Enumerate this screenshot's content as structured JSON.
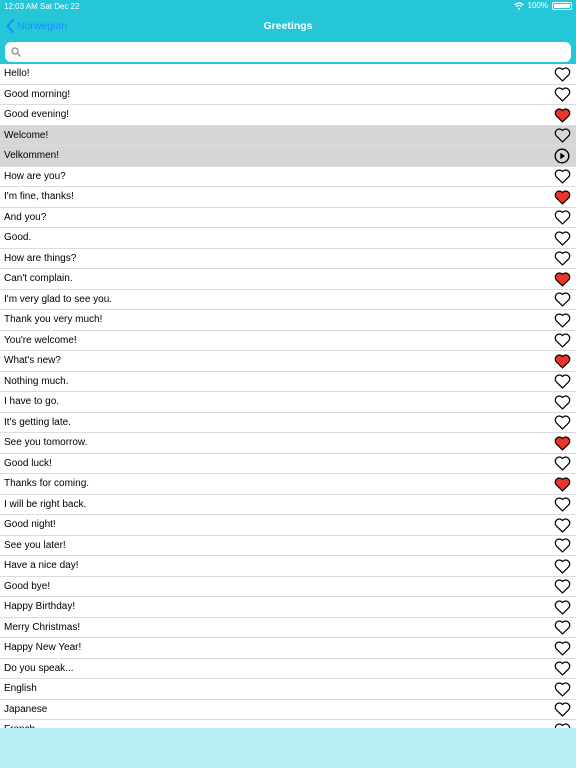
{
  "status_bar": {
    "time": "12:03 AM",
    "date": "Sat Dec 22",
    "battery": "100%"
  },
  "nav": {
    "back_label": "Norwegian",
    "title": "Greetings"
  },
  "search": {
    "placeholder": ""
  },
  "colors": {
    "header": "#26c6d9",
    "heart_filled": "#e8362c",
    "back_link": "#1a8cff",
    "selected_row": "#d6d6d6"
  },
  "rows": [
    {
      "label": "Hello!",
      "icon": "heart-outline-icon"
    },
    {
      "label": "Good morning!",
      "icon": "heart-outline-icon"
    },
    {
      "label": "Good evening!",
      "icon": "heart-filled-icon"
    },
    {
      "label": "Welcome!",
      "icon": "heart-outline-icon",
      "selected": true
    },
    {
      "label": "Velkommen!",
      "icon": "play-circle-icon",
      "selected": true
    },
    {
      "label": "How are you?",
      "icon": "heart-outline-icon"
    },
    {
      "label": "I'm fine, thanks!",
      "icon": "heart-filled-icon"
    },
    {
      "label": "And you?",
      "icon": "heart-outline-icon"
    },
    {
      "label": "Good.",
      "icon": "heart-outline-icon"
    },
    {
      "label": "How are things?",
      "icon": "heart-outline-icon"
    },
    {
      "label": "Can't complain.",
      "icon": "heart-filled-icon"
    },
    {
      "label": "I'm very glad to see you.",
      "icon": "heart-outline-icon"
    },
    {
      "label": "Thank you very much!",
      "icon": "heart-outline-icon"
    },
    {
      "label": "You're welcome!",
      "icon": "heart-outline-icon"
    },
    {
      "label": "What's new?",
      "icon": "heart-filled-icon"
    },
    {
      "label": "Nothing much.",
      "icon": "heart-outline-icon"
    },
    {
      "label": "I have to go.",
      "icon": "heart-outline-icon"
    },
    {
      "label": "It's getting late.",
      "icon": "heart-outline-icon"
    },
    {
      "label": "See you tomorrow.",
      "icon": "heart-filled-icon"
    },
    {
      "label": "Good luck!",
      "icon": "heart-outline-icon"
    },
    {
      "label": "Thanks for coming.",
      "icon": "heart-filled-icon"
    },
    {
      "label": "I will be right back.",
      "icon": "heart-outline-icon"
    },
    {
      "label": "Good night!",
      "icon": "heart-outline-icon"
    },
    {
      "label": "See you later!",
      "icon": "heart-outline-icon"
    },
    {
      "label": "Have a nice day!",
      "icon": "heart-outline-icon"
    },
    {
      "label": "Good bye!",
      "icon": "heart-outline-icon"
    },
    {
      "label": "Happy Birthday!",
      "icon": "heart-outline-icon"
    },
    {
      "label": "Merry Christmas!",
      "icon": "heart-outline-icon"
    },
    {
      "label": "Happy New Year!",
      "icon": "heart-outline-icon"
    },
    {
      "label": "Do you speak...",
      "icon": "heart-outline-icon"
    },
    {
      "label": "English",
      "icon": "heart-outline-icon"
    },
    {
      "label": "Japanese",
      "icon": "heart-outline-icon"
    },
    {
      "label": "French",
      "icon": "heart-outline-icon"
    }
  ]
}
